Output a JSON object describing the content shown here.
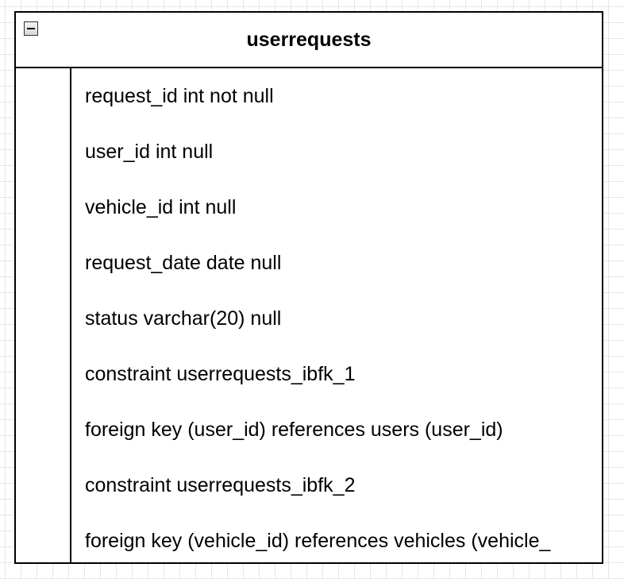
{
  "table": {
    "title": "userrequests",
    "rows": [
      "request_id int not null",
      "user_id int null",
      "vehicle_id int null",
      "request_date date null",
      "status varchar(20) null",
      "constraint userrequests_ibfk_1",
      "foreign key (user_id) references users (user_id)",
      "constraint userrequests_ibfk_2",
      "foreign key (vehicle_id) references vehicles (vehicle_"
    ]
  },
  "icons": {
    "collapse": "minus-box-icon"
  }
}
